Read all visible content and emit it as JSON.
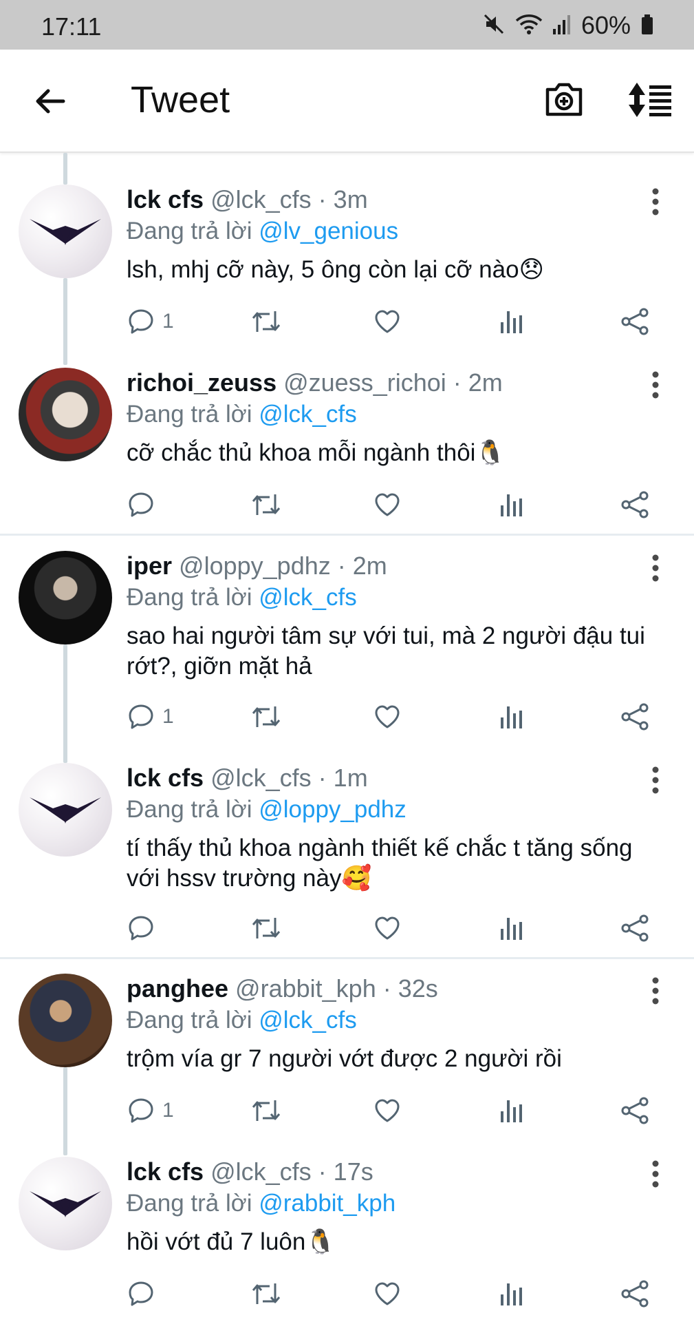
{
  "status_bar": {
    "time": "17:11",
    "battery": "60%"
  },
  "appbar": {
    "title": "Tweet"
  },
  "tweets": [
    {
      "name": "lck cfs",
      "handle": "@lck_cfs",
      "time": "3m",
      "reply_label": "Đang trả lời",
      "reply_to": "@lv_genious",
      "text": "lsh, mhj cỡ này, 5 ông còn lại cỡ nào😞",
      "reply_count": "1"
    },
    {
      "name": "richoi_zeuss",
      "handle": "@zuess_richoi",
      "time": "2m",
      "reply_label": "Đang trả lời",
      "reply_to": "@lck_cfs",
      "text": "cỡ chắc thủ khoa mỗi ngành thôi🐧",
      "reply_count": ""
    },
    {
      "name": "iper",
      "handle": "@loppy_pdhz",
      "time": "2m",
      "reply_label": "Đang trả lời",
      "reply_to": "@lck_cfs",
      "text": "sao hai người tâm sự với tui, mà 2 người đậu tui rớt?, giỡn mặt hả",
      "reply_count": "1"
    },
    {
      "name": "lck cfs",
      "handle": "@lck_cfs",
      "time": "1m",
      "reply_label": "Đang trả lời",
      "reply_to": "@loppy_pdhz",
      "text": "tí thấy thủ khoa ngành thiết kế chắc t tăng sống với hssv trường này🥰",
      "reply_count": ""
    },
    {
      "name": "panghee",
      "handle": "@rabbit_kph",
      "time": "32s",
      "reply_label": "Đang trả lời",
      "reply_to": "@lck_cfs",
      "text": "trộm vía gr 7 người vớt được 2 người rồi",
      "reply_count": "1"
    },
    {
      "name": "lck cfs",
      "handle": "@lck_cfs",
      "time": "17s",
      "reply_label": "Đang trả lời",
      "reply_to": "@rabbit_kph",
      "text": "hồi vớt đủ 7 luôn🐧",
      "reply_count": ""
    }
  ],
  "colors": {
    "mention": "#1d9bf0",
    "muted": "#6b7780",
    "thread_line": "#cfd9de"
  }
}
